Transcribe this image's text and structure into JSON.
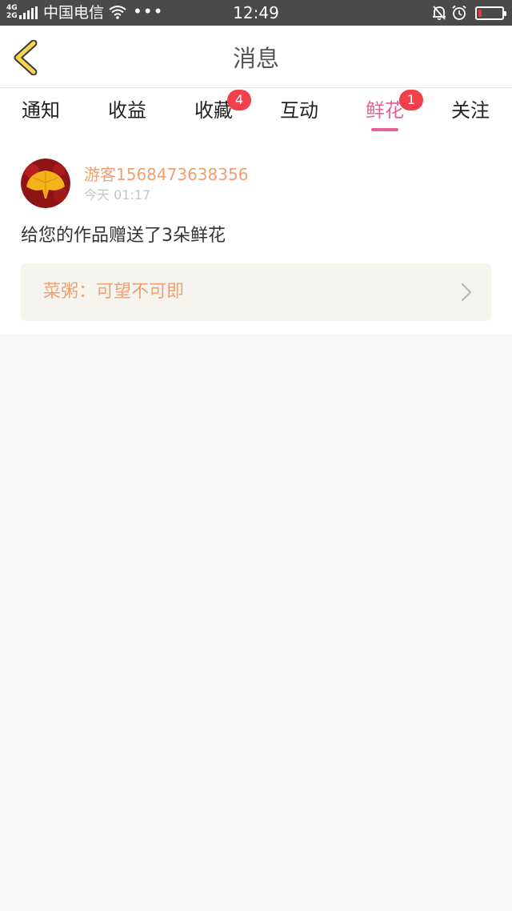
{
  "status_bar": {
    "network": "4G\n2G",
    "carrier": "中国电信",
    "more": "•••",
    "time": "12:49"
  },
  "header": {
    "title": "消息",
    "back_icon": "chevron-left-icon"
  },
  "tabs": [
    {
      "label": "通知",
      "badge": null,
      "active": false
    },
    {
      "label": "收益",
      "badge": null,
      "active": false
    },
    {
      "label": "收藏",
      "badge": "4",
      "active": false
    },
    {
      "label": "互动",
      "badge": null,
      "active": false
    },
    {
      "label": "鲜花",
      "badge": "1",
      "active": true
    },
    {
      "label": "关注",
      "badge": null,
      "active": false
    }
  ],
  "message": {
    "username": "游客1568473638356",
    "time": "今天 01:17",
    "text": "给您的作品赠送了3朵鲜花",
    "work_title": "菜粥：可望不可即"
  },
  "colors": {
    "accent": "#e8619a",
    "badge": "#f2404a",
    "username": "#f0a072",
    "back_arrow": "#f5d34a"
  }
}
